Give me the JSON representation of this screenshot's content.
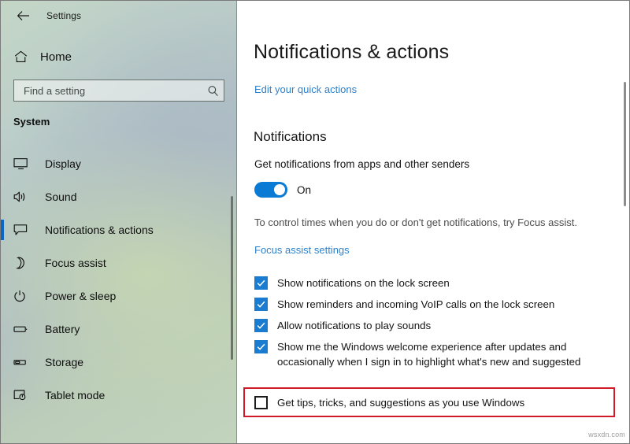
{
  "window": {
    "title": "Settings",
    "back_icon": "back-arrow-icon",
    "controls": {
      "minimize": "–",
      "maximize": "□",
      "close": "✕"
    }
  },
  "sidebar": {
    "home": {
      "label": "Home",
      "icon": "home-icon"
    },
    "search": {
      "value": "",
      "placeholder": "Find a setting",
      "icon": "search-icon"
    },
    "section_title": "System",
    "items": [
      {
        "label": "Display",
        "icon": "monitor-icon",
        "active": false
      },
      {
        "label": "Sound",
        "icon": "speaker-icon",
        "active": false
      },
      {
        "label": "Notifications & actions",
        "icon": "notification-icon",
        "active": true
      },
      {
        "label": "Focus assist",
        "icon": "moon-icon",
        "active": false
      },
      {
        "label": "Power & sleep",
        "icon": "power-icon",
        "active": false
      },
      {
        "label": "Battery",
        "icon": "battery-icon",
        "active": false
      },
      {
        "label": "Storage",
        "icon": "storage-icon",
        "active": false
      },
      {
        "label": "Tablet mode",
        "icon": "tablet-mode-icon",
        "active": false
      }
    ]
  },
  "main": {
    "page_title": "Notifications & actions",
    "quick_actions_link": "Edit your quick actions",
    "notifications_heading": "Notifications",
    "master_toggle": {
      "label": "Get notifications from apps and other senders",
      "state_text": "On",
      "on": true
    },
    "description": "To control times when you do or don't get notifications, try Focus assist.",
    "description_link": "Focus assist settings",
    "checkboxes": [
      {
        "label": "Show notifications on the lock screen",
        "checked": true
      },
      {
        "label": "Show reminders and incoming VoIP calls on the lock screen",
        "checked": true
      },
      {
        "label": "Allow notifications to play sounds",
        "checked": true
      },
      {
        "label": "Show me the Windows welcome experience after updates and occasionally when I sign in to highlight what's new and suggested",
        "checked": true
      }
    ],
    "highlighted_checkbox": {
      "label": "Get tips, tricks, and suggestions as you use Windows",
      "checked": false
    }
  },
  "watermark": "wsxdn.com",
  "colors": {
    "accent_blue": "#0a7bd4",
    "link_blue": "#2e81c9",
    "selection_blue": "#0a68c4",
    "highlight_red": "#d01a27",
    "sidebar_green": "#c3d6c6"
  }
}
